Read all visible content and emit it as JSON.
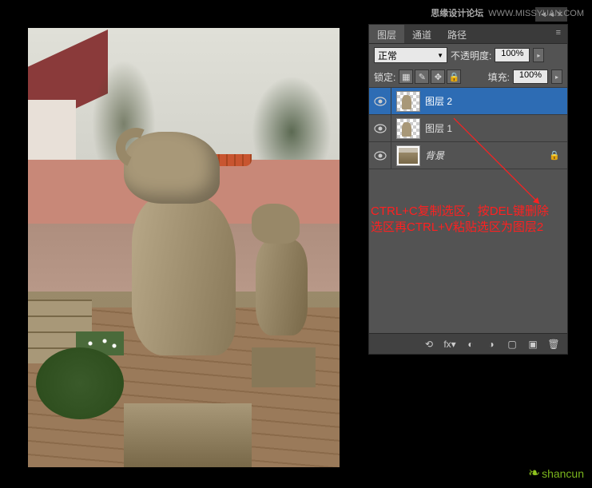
{
  "watermark": {
    "top_main": "思缘设计论坛",
    "top_url": "WWW.MISSYUAN.COM",
    "bottom": "shancun"
  },
  "panel": {
    "tabs": [
      "图层",
      "通道",
      "路径"
    ],
    "blend_mode": "正常",
    "opacity_label": "不透明度:",
    "opacity_value": "100%",
    "lock_label": "锁定:",
    "fill_label": "填充:",
    "fill_value": "100%",
    "layers": [
      {
        "name": "图层 2",
        "selected": true,
        "locked": false,
        "thumb": "statue-checker"
      },
      {
        "name": "图层 1",
        "selected": false,
        "locked": false,
        "thumb": "statue-checker"
      },
      {
        "name": "背景",
        "selected": false,
        "locked": true,
        "italic": true,
        "thumb": "full"
      }
    ]
  },
  "annotation": {
    "line1": "CTRL+C复制选区，按DEL键删除",
    "line2": "选区再CTRL+V粘贴选区为图层2"
  },
  "icons": {
    "collapse": "◄◄",
    "close": "✕",
    "menu": "≡",
    "arrow_down": "▼",
    "arrow_right": "▸",
    "lock_trans": "▦",
    "lock_paint": "✎",
    "lock_move": "✥",
    "lock_all": "🔒",
    "link": "⟲",
    "fx": "fx▾",
    "mask": "◐",
    "adjust": "◑",
    "folder": "▢",
    "new": "▣",
    "trash": "🗑"
  }
}
